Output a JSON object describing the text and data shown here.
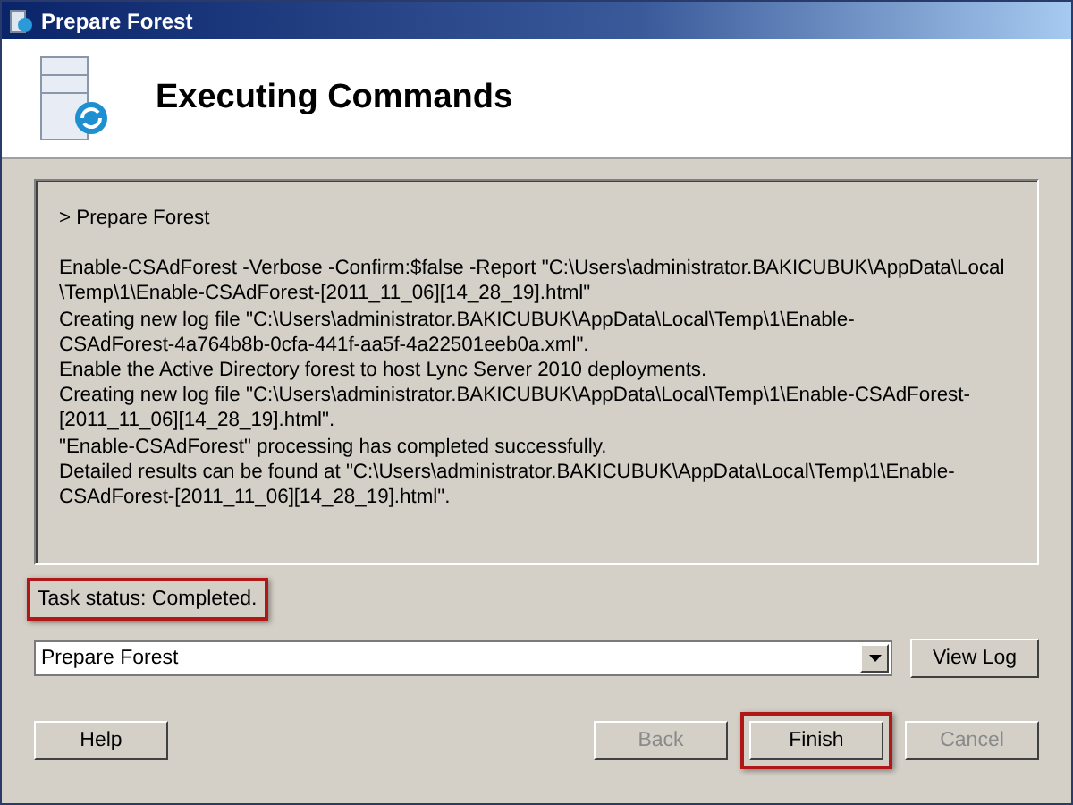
{
  "window": {
    "title": "Prepare Forest"
  },
  "header": {
    "title": "Executing Commands"
  },
  "log": {
    "heading": "> Prepare Forest",
    "lines": [
      "Enable-CSAdForest  -Verbose -Confirm:$false -Report \"C:\\Users\\administrator.BAKICUBUK\\AppData\\Local",
      "\\Temp\\1\\Enable-CSAdForest-[2011_11_06][14_28_19].html\"",
      "Creating new log file \"C:\\Users\\administrator.BAKICUBUK\\AppData\\Local\\Temp\\1\\Enable-",
      "CSAdForest-4a764b8b-0cfa-441f-aa5f-4a22501eeb0a.xml\".",
      "Enable the Active Directory forest to host Lync Server 2010 deployments.",
      "Creating new log file \"C:\\Users\\administrator.BAKICUBUK\\AppData\\Local\\Temp\\1\\Enable-CSAdForest-",
      "[2011_11_06][14_28_19].html\".",
      "\"Enable-CSAdForest\" processing has completed successfully.",
      "Detailed results can be found at \"C:\\Users\\administrator.BAKICUBUK\\AppData\\Local\\Temp\\1\\Enable-",
      "CSAdForest-[2011_11_06][14_28_19].html\"."
    ]
  },
  "status": {
    "text": "Task status: Completed.",
    "highlighted": true
  },
  "task_select": {
    "value": "Prepare Forest"
  },
  "view_log_button": {
    "label": "View Log",
    "disabled": false
  },
  "buttons": [
    {
      "label": "Help",
      "disabled": false,
      "highlighted": false
    },
    {
      "label": "Back",
      "disabled": true,
      "highlighted": false
    },
    {
      "label": "Finish",
      "disabled": false,
      "highlighted": true
    },
    {
      "label": "Cancel",
      "disabled": true,
      "highlighted": false
    }
  ]
}
